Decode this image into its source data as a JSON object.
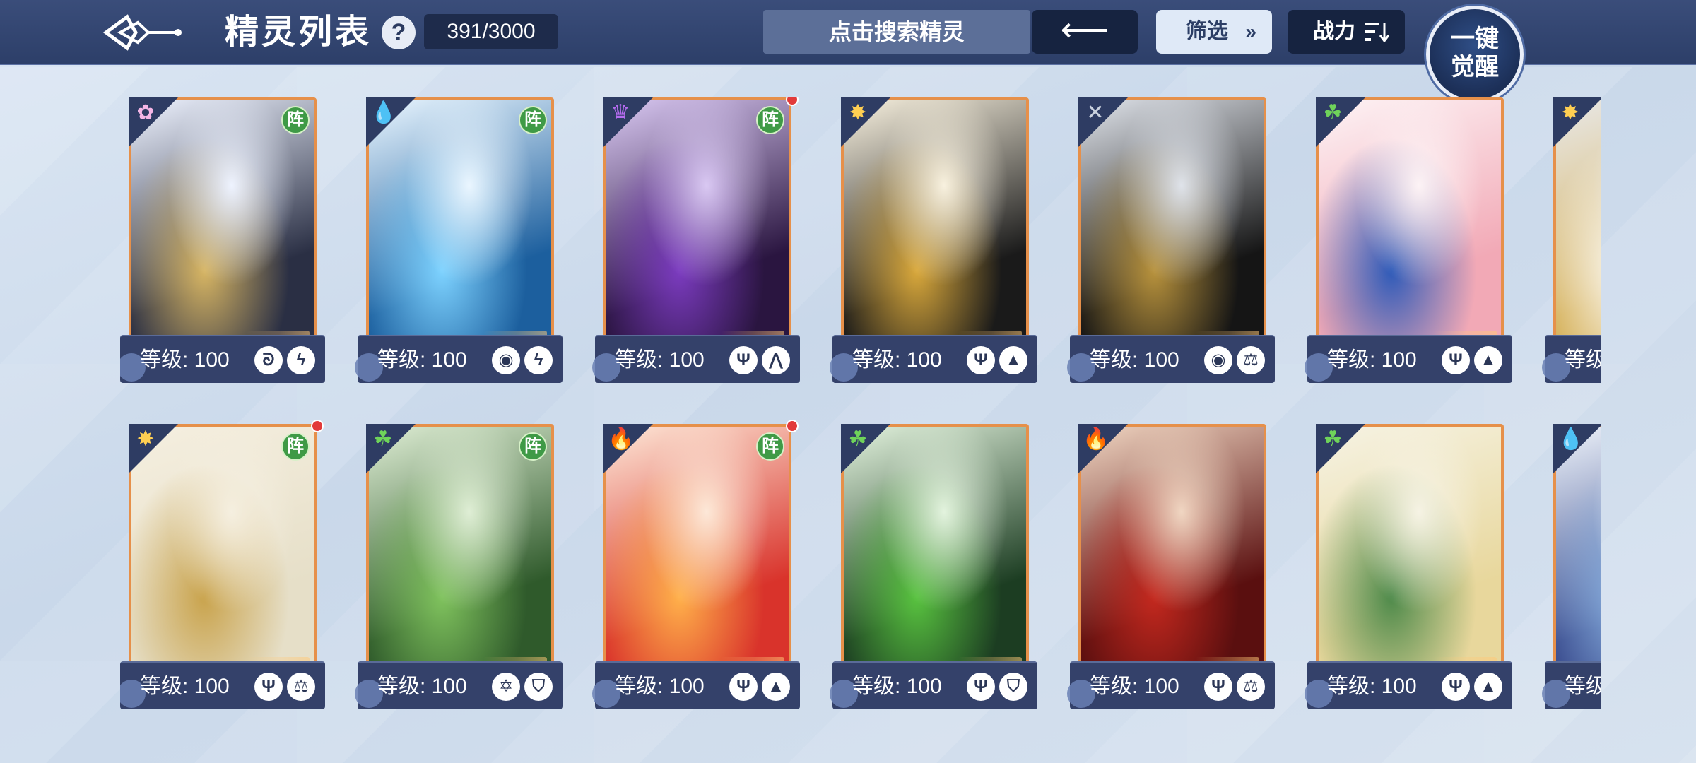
{
  "header": {
    "title": "精灵列表",
    "help_label": "?",
    "count": "391/3000",
    "search_placeholder": "点击搜索精灵",
    "back_label": "⟵",
    "filter_label": "筛选",
    "filter_icon": "chevron-double-down",
    "power_label": "战力",
    "power_icon": "sort-icon",
    "awaken_label_line1": "一键",
    "awaken_label_line2": "觉醒"
  },
  "colors": {
    "topbar": "#2d3f69",
    "card_border": "#e6904a",
    "level_bar": "#34416a",
    "formation_badge": "#3f9a46",
    "red_dot": "#e23a3a"
  },
  "cards": [
    {
      "element": "rainbow-flower-icon",
      "element_glyph": "✿",
      "element_color": "#f4b6e6",
      "formation": "阵",
      "red_dot": false,
      "level": "等级: 100",
      "skills": [
        "swirl-icon",
        "lightning-icon"
      ],
      "skill_glyphs": [
        "ᘐ",
        "ϟ"
      ],
      "art": [
        "#2a2f44",
        "#d7b563",
        "#eef3ff"
      ]
    },
    {
      "element": "water-drop-icon",
      "element_glyph": "💧",
      "element_color": "#5cb4ff",
      "formation": "阵",
      "red_dot": false,
      "level": "等级: 100",
      "skills": [
        "vortex-icon",
        "lightning-icon"
      ],
      "skill_glyphs": [
        "◉",
        "ϟ"
      ],
      "art": [
        "#1c5f9e",
        "#7dd2ff",
        "#eaf6ff"
      ]
    },
    {
      "element": "dark-crown-icon",
      "element_glyph": "♛",
      "element_color": "#b56cf0",
      "formation": "阵",
      "red_dot": true,
      "level": "等级: 100",
      "skills": [
        "trident-icon",
        "claw-icon"
      ],
      "skill_glyphs": [
        "Ψ",
        "⋀"
      ],
      "art": [
        "#2a1540",
        "#7b3bbf",
        "#d9c8f2"
      ]
    },
    {
      "element": "light-sun-icon",
      "element_glyph": "✸",
      "element_color": "#ffcf52",
      "formation": "",
      "red_dot": false,
      "level": "等级: 100",
      "skills": [
        "trident-icon",
        "book-icon"
      ],
      "skill_glyphs": [
        "Ψ",
        "▲"
      ],
      "art": [
        "#1a1a1a",
        "#d9a83b",
        "#f8f1df"
      ]
    },
    {
      "element": "crossed-swords-icon",
      "element_glyph": "✕",
      "element_color": "#c9d1de",
      "formation": "",
      "red_dot": false,
      "level": "等级: 100",
      "skills": [
        "vortex-icon",
        "balance-icon"
      ],
      "skill_glyphs": [
        "◉",
        "⚖"
      ],
      "art": [
        "#151515",
        "#b8923c",
        "#dfe3ea"
      ]
    },
    {
      "element": "leaf-icon",
      "element_glyph": "☘",
      "element_color": "#6fd35a",
      "formation": "",
      "red_dot": false,
      "level": "等级: 100",
      "skills": [
        "trident-icon",
        "book-icon"
      ],
      "skill_glyphs": [
        "Ψ",
        "▲"
      ],
      "art": [
        "#f2a9b6",
        "#2e5ab8",
        "#fdf3f5"
      ]
    },
    {
      "element": "light-sun-icon",
      "element_glyph": "✸",
      "element_color": "#ffcf52",
      "formation": "",
      "red_dot": false,
      "level": "等级",
      "skills": [],
      "skill_glyphs": [],
      "art": [
        "#d6b25c",
        "#ffffff",
        "#e8e8e8"
      ]
    },
    {
      "element": "light-sun-icon",
      "element_glyph": "✸",
      "element_color": "#ffcf52",
      "formation": "阵",
      "red_dot": true,
      "level": "等级: 100",
      "skills": [
        "trident-icon",
        "balance-icon"
      ],
      "skill_glyphs": [
        "Ψ",
        "⚖"
      ],
      "art": [
        "#e6dfc8",
        "#c9a34c",
        "#f5efe0"
      ]
    },
    {
      "element": "leaf-icon",
      "element_glyph": "☘",
      "element_color": "#6fd35a",
      "formation": "阵",
      "red_dot": false,
      "level": "等级: 100",
      "skills": [
        "hexagram-icon",
        "shield-icon"
      ],
      "skill_glyphs": [
        "✡",
        "⛉"
      ],
      "art": [
        "#2f5a2b",
        "#7fc25d",
        "#dfeed5"
      ]
    },
    {
      "element": "fire-icon",
      "element_glyph": "🔥",
      "element_color": "#ff6a4a",
      "formation": "阵",
      "red_dot": true,
      "level": "等级: 100",
      "skills": [
        "trident-icon",
        "book-icon"
      ],
      "skill_glyphs": [
        "Ψ",
        "▲"
      ],
      "art": [
        "#d9332b",
        "#ffb04a",
        "#fde8d8"
      ]
    },
    {
      "element": "leaf-icon",
      "element_glyph": "☘",
      "element_color": "#6fd35a",
      "formation": "",
      "red_dot": false,
      "level": "等级: 100",
      "skills": [
        "trident-icon",
        "shield-icon"
      ],
      "skill_glyphs": [
        "Ψ",
        "⛉"
      ],
      "art": [
        "#1c3d22",
        "#58c23f",
        "#e3f3de"
      ]
    },
    {
      "element": "fire-icon",
      "element_glyph": "🔥",
      "element_color": "#ff6a4a",
      "formation": "",
      "red_dot": false,
      "level": "等级: 100",
      "skills": [
        "trident-icon",
        "balance-icon"
      ],
      "skill_glyphs": [
        "Ψ",
        "⚖"
      ],
      "art": [
        "#5a0f0f",
        "#c3281e",
        "#f0d6c2"
      ]
    },
    {
      "element": "leaf-icon",
      "element_glyph": "☘",
      "element_color": "#6fd35a",
      "formation": "",
      "red_dot": false,
      "level": "等级: 100",
      "skills": [
        "trident-icon",
        "book-icon"
      ],
      "skill_glyphs": [
        "Ψ",
        "▲"
      ],
      "art": [
        "#e8d79c",
        "#4e8a4a",
        "#f6f3e4"
      ]
    },
    {
      "element": "water-drop-icon",
      "element_glyph": "💧",
      "element_color": "#5cb4ff",
      "formation": "",
      "red_dot": false,
      "level": "等级",
      "skills": [],
      "skill_glyphs": [],
      "art": [
        "#3b4d8f",
        "#8fb8e6",
        "#eef3fa"
      ]
    }
  ]
}
